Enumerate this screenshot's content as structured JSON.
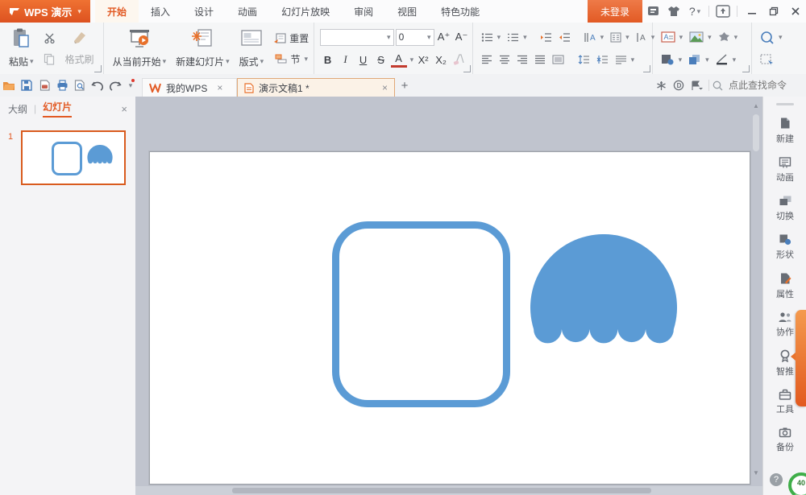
{
  "window": {
    "logo_text": "WPS 演示",
    "menu_tabs": [
      "开始",
      "插入",
      "设计",
      "动画",
      "幻灯片放映",
      "审阅",
      "视图",
      "特色功能"
    ],
    "active_tab": "开始",
    "login_label": "未登录",
    "help_label": "?"
  },
  "ribbon": {
    "paste_label": "粘贴",
    "format_painter_label": "格式刷",
    "play_current_label": "从当前开始",
    "new_slide_label": "新建幻灯片",
    "layout_label": "版式",
    "reset_label": "重置",
    "section_label": "节",
    "font_size_value": "0",
    "font_grow": "A⁺",
    "font_shrink": "A⁻",
    "bold": "B",
    "italic": "I",
    "underline": "U",
    "strike": "S",
    "font_color": "A",
    "superscript": "X²",
    "subscript": "X₂"
  },
  "quickbar": {
    "doc_tabs": [
      {
        "label": "我的WPS",
        "active": false
      },
      {
        "label": "演示文稿1 *",
        "active": true
      }
    ],
    "search_placeholder": "点此查找命令"
  },
  "left_panel": {
    "outline_tab": "大纲",
    "slides_tab": "幻灯片",
    "separator": "|",
    "slide_number": "1"
  },
  "sidebar": {
    "items": [
      {
        "label": "新建"
      },
      {
        "label": "动画"
      },
      {
        "label": "切换"
      },
      {
        "label": "形状"
      },
      {
        "label": "属性"
      },
      {
        "label": "协作"
      },
      {
        "label": "智推"
      },
      {
        "label": "工具"
      },
      {
        "label": "备份"
      }
    ],
    "gauge_value": "40"
  },
  "icons": {
    "caret_down": "▾",
    "close": "×",
    "plus": "+",
    "up_arrow": "▲",
    "down_arrow": "▼"
  },
  "colors": {
    "accent_orange": "#e25a24",
    "shape_blue": "#5b9bd5"
  }
}
